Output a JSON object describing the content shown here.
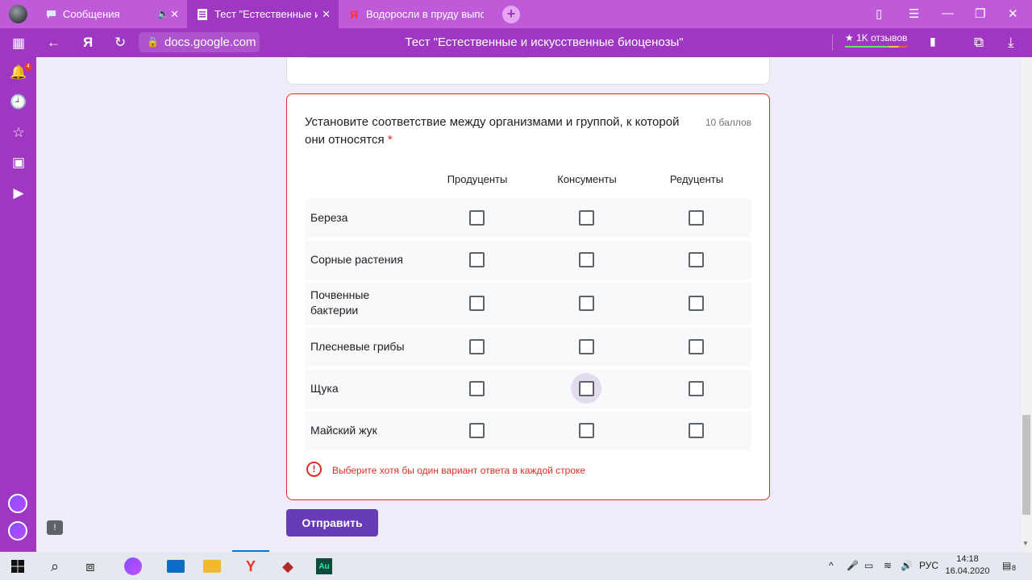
{
  "browser": {
    "tabs": [
      {
        "title": "Сообщения",
        "icon": "chat-bubble-icon"
      },
      {
        "title": "Тест \"Естественные и искусственные биоценозы\"",
        "icon": "forms-icon"
      },
      {
        "title": "Водоросли в пруду выполняют",
        "icon": "yandex-icon"
      }
    ],
    "url": "docs.google.com",
    "page_title": "Тест \"Естественные и искусственные биоценозы\"",
    "reviews": "★ 1K отзывов",
    "notification_badge": "4",
    "accent_color": "#9f37c2"
  },
  "question": {
    "text": "Установите соответствие между организмами и группой, к которой они относятся",
    "required_mark": "*",
    "points": "10 баллов",
    "columns": [
      "Продуценты",
      "Консументы",
      "Редуценты"
    ],
    "rows": [
      {
        "label": "Береза"
      },
      {
        "label": "Сорные растения"
      },
      {
        "label": "Почвенные бактерии"
      },
      {
        "label": "Плесневые грибы"
      },
      {
        "label": "Щука"
      },
      {
        "label": "Майский жук"
      }
    ],
    "error": "Выберите хотя бы один вариант ответа в каждой строке"
  },
  "submit_label": "Отправить",
  "taskbar": {
    "language": "РУС",
    "time": "14:18",
    "date": "16.04.2020",
    "notifications": "8"
  }
}
